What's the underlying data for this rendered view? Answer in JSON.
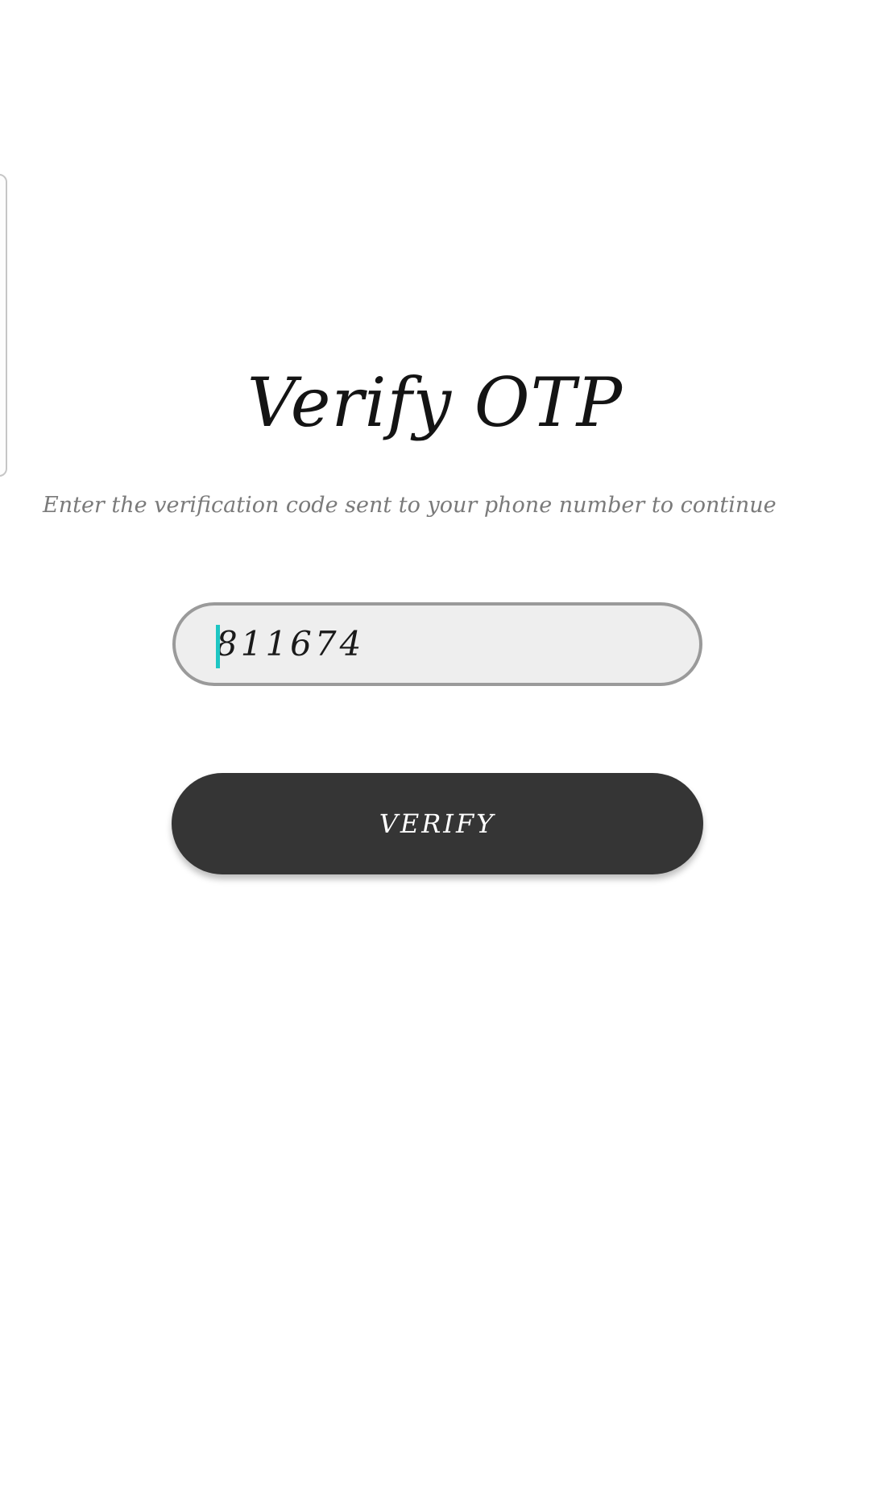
{
  "screen": {
    "title": "Verify OTP",
    "subtitle": "Enter the verification code sent to your phone number to continue"
  },
  "otp_input": {
    "value": "811674"
  },
  "verify_button": {
    "label": "VERIFY"
  },
  "colors": {
    "background": "#ffffff",
    "button": "#353535",
    "field": "#eeeeee",
    "field_border": "#9a9a9a",
    "cursor": "#1ec6c3",
    "subtitle": "#7a7a7a"
  }
}
